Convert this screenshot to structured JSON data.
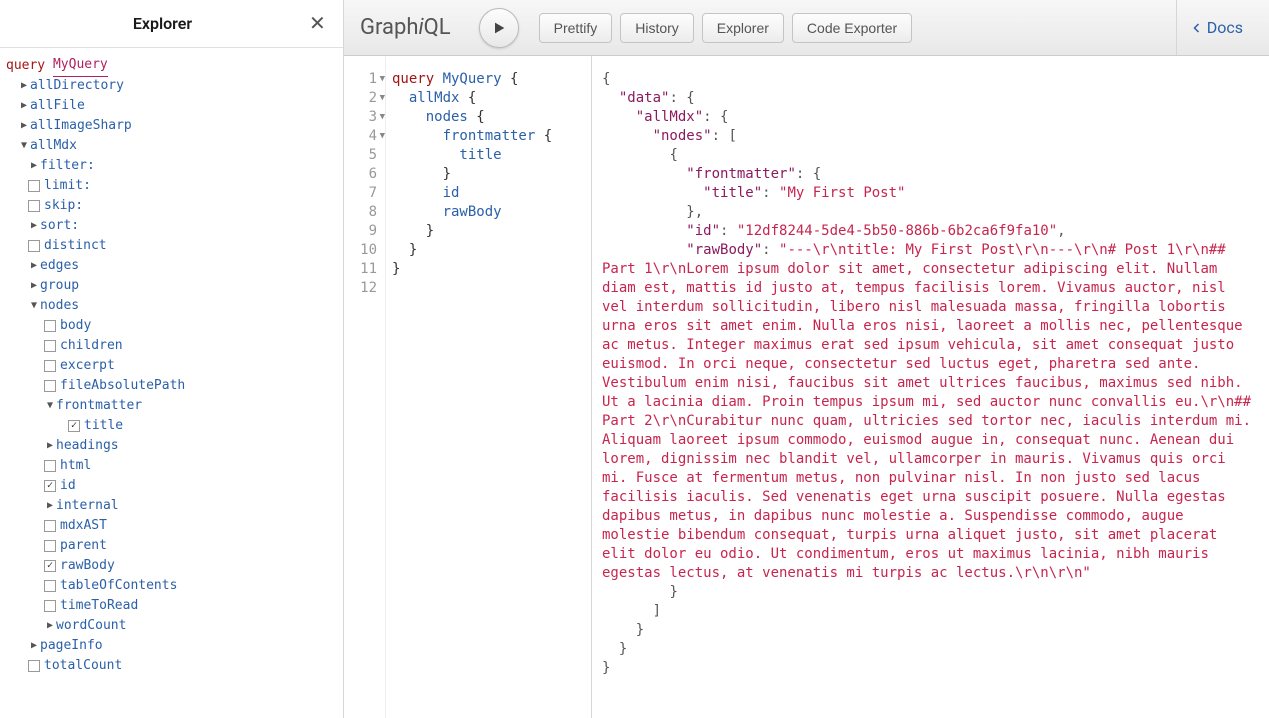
{
  "explorer": {
    "title": "Explorer",
    "query_kw": "query",
    "query_name": "MyQuery",
    "tree": [
      {
        "ind": 1,
        "arrow": "▶",
        "label": "allDirectory"
      },
      {
        "ind": 1,
        "arrow": "▶",
        "label": "allFile"
      },
      {
        "ind": 1,
        "arrow": "▶",
        "label": "allImageSharp"
      },
      {
        "ind": 1,
        "arrow": "▼",
        "label": "allMdx"
      },
      {
        "ind": 2,
        "arrow": "▶",
        "label": "filter:"
      },
      {
        "ind": 2,
        "check": false,
        "label": "limit:"
      },
      {
        "ind": 2,
        "check": false,
        "label": "skip:"
      },
      {
        "ind": 2,
        "arrow": "▶",
        "label": "sort:"
      },
      {
        "ind": 2,
        "check": false,
        "label": "distinct"
      },
      {
        "ind": 2,
        "arrow": "▶",
        "label": "edges"
      },
      {
        "ind": 2,
        "arrow": "▶",
        "label": "group"
      },
      {
        "ind": 2,
        "arrow": "▼",
        "label": "nodes"
      },
      {
        "ind": 3,
        "check": false,
        "label": "body"
      },
      {
        "ind": 3,
        "check": false,
        "label": "children"
      },
      {
        "ind": 3,
        "check": false,
        "label": "excerpt"
      },
      {
        "ind": 3,
        "check": false,
        "label": "fileAbsolutePath"
      },
      {
        "ind": 3,
        "arrow": "▼",
        "label": "frontmatter"
      },
      {
        "ind": 5,
        "check": true,
        "label": "title"
      },
      {
        "ind": 3,
        "arrow": "▶",
        "label": "headings"
      },
      {
        "ind": 3,
        "check": false,
        "label": "html"
      },
      {
        "ind": 3,
        "check": true,
        "label": "id"
      },
      {
        "ind": 3,
        "arrow": "▶",
        "label": "internal"
      },
      {
        "ind": 3,
        "check": false,
        "label": "mdxAST"
      },
      {
        "ind": 3,
        "check": false,
        "label": "parent"
      },
      {
        "ind": 3,
        "check": true,
        "label": "rawBody"
      },
      {
        "ind": 3,
        "check": false,
        "label": "tableOfContents"
      },
      {
        "ind": 3,
        "check": false,
        "label": "timeToRead"
      },
      {
        "ind": 3,
        "arrow": "▶",
        "label": "wordCount"
      },
      {
        "ind": 2,
        "arrow": "▶",
        "label": "pageInfo"
      },
      {
        "ind": 2,
        "check": false,
        "label": "totalCount"
      }
    ]
  },
  "toolbar": {
    "logo": "GraphiQL",
    "buttons": [
      "Prettify",
      "History",
      "Explorer",
      "Code Exporter"
    ],
    "docs": "Docs"
  },
  "editor": {
    "lines": [
      {
        "n": 1,
        "fold": "▼",
        "t": "query MyQuery {",
        "parts": [
          [
            "kw",
            "query "
          ],
          [
            "nm",
            "MyQuery"
          ],
          [
            "pun",
            " {"
          ]
        ]
      },
      {
        "n": 2,
        "fold": "▼",
        "t": "  allMdx {",
        "parts": [
          [
            "fn",
            "  allMdx"
          ],
          [
            "pun",
            " {"
          ]
        ]
      },
      {
        "n": 3,
        "fold": "▼",
        "t": "    nodes {",
        "parts": [
          [
            "fn",
            "    nodes"
          ],
          [
            "pun",
            " {"
          ]
        ]
      },
      {
        "n": 4,
        "fold": "▼",
        "t": "      frontmatter {",
        "parts": [
          [
            "fn",
            "      frontmatter"
          ],
          [
            "pun",
            " {"
          ]
        ]
      },
      {
        "n": 5,
        "t": "        title",
        "parts": [
          [
            "fn",
            "        title"
          ]
        ]
      },
      {
        "n": 6,
        "t": "      }",
        "parts": [
          [
            "pun",
            "      }"
          ]
        ]
      },
      {
        "n": 7,
        "t": "      id",
        "parts": [
          [
            "fn",
            "      id"
          ]
        ]
      },
      {
        "n": 8,
        "t": "      rawBody",
        "parts": [
          [
            "fn",
            "      rawBody"
          ]
        ]
      },
      {
        "n": 9,
        "t": "    }",
        "parts": [
          [
            "pun",
            "    }"
          ]
        ]
      },
      {
        "n": 10,
        "t": "  }",
        "parts": [
          [
            "pun",
            "  }"
          ]
        ]
      },
      {
        "n": 11,
        "t": "}",
        "parts": [
          [
            "pun",
            "}"
          ]
        ]
      },
      {
        "n": 12,
        "t": "",
        "parts": []
      }
    ]
  },
  "result": {
    "tokens": [
      [
        "pun",
        "{"
      ],
      [
        "br"
      ],
      [
        "pun",
        "  "
      ],
      [
        "key",
        "\"data\""
      ],
      [
        "pun",
        ": {"
      ],
      [
        "br"
      ],
      [
        "pun",
        "    "
      ],
      [
        "key",
        "\"allMdx\""
      ],
      [
        "pun",
        ": {"
      ],
      [
        "br"
      ],
      [
        "pun",
        "      "
      ],
      [
        "key",
        "\"nodes\""
      ],
      [
        "pun",
        ": ["
      ],
      [
        "br"
      ],
      [
        "pun",
        "        {"
      ],
      [
        "br"
      ],
      [
        "pun",
        "          "
      ],
      [
        "key",
        "\"frontmatter\""
      ],
      [
        "pun",
        ": {"
      ],
      [
        "br"
      ],
      [
        "pun",
        "            "
      ],
      [
        "key",
        "\"title\""
      ],
      [
        "pun",
        ": "
      ],
      [
        "str",
        "\"My First Post\""
      ],
      [
        "br"
      ],
      [
        "pun",
        "          },"
      ],
      [
        "br"
      ],
      [
        "pun",
        "          "
      ],
      [
        "key",
        "\"id\""
      ],
      [
        "pun",
        ": "
      ],
      [
        "str",
        "\"12df8244-5de4-5b50-886b-6b2ca6f9fa10\""
      ],
      [
        "pun",
        ","
      ],
      [
        "br"
      ],
      [
        "pun",
        "          "
      ],
      [
        "key",
        "\"rawBody\""
      ],
      [
        "pun",
        ": "
      ],
      [
        "str",
        "\"---\\r\\ntitle: My First Post\\r\\n---\\r\\n# Post 1\\r\\n## Part 1\\r\\nLorem ipsum dolor sit amet, consectetur adipiscing elit. Nullam diam est, mattis id justo at, tempus facilisis lorem. Vivamus auctor, nisl vel interdum sollicitudin, libero nisl malesuada massa, fringilla lobortis urna eros sit amet enim. Nulla eros nisi, laoreet a mollis nec, pellentesque ac metus. Integer maximus erat sed ipsum vehicula, sit amet consequat justo euismod. In orci neque, consectetur sed luctus eget, pharetra sed ante. Vestibulum enim nisi, faucibus sit amet ultrices faucibus, maximus sed nibh. Ut a lacinia diam. Proin tempus ipsum mi, sed auctor nunc convallis eu.\\r\\n## Part 2\\r\\nCurabitur nunc quam, ultricies sed tortor nec, iaculis interdum mi. Aliquam laoreet ipsum commodo, euismod augue in, consequat nunc. Aenean dui lorem, dignissim nec blandit vel, ullamcorper in mauris. Vivamus quis orci mi. Fusce at fermentum metus, non pulvinar nisl. In non justo sed lacus facilisis iaculis. Sed venenatis eget urna suscipit posuere. Nulla egestas dapibus metus, in dapibus nunc molestie a. Suspendisse commodo, augue molestie bibendum consequat, turpis urna aliquet justo, sit amet placerat elit dolor eu odio. Ut condimentum, eros ut maximus lacinia, nibh mauris egestas lectus, at venenatis mi turpis ac lectus.\\r\\n\\r\\n\""
      ],
      [
        "br"
      ],
      [
        "pun",
        "        }"
      ],
      [
        "br"
      ],
      [
        "pun",
        "      ]"
      ],
      [
        "br"
      ],
      [
        "pun",
        "    }"
      ],
      [
        "br"
      ],
      [
        "pun",
        "  }"
      ],
      [
        "br"
      ],
      [
        "pun",
        "}"
      ]
    ]
  }
}
